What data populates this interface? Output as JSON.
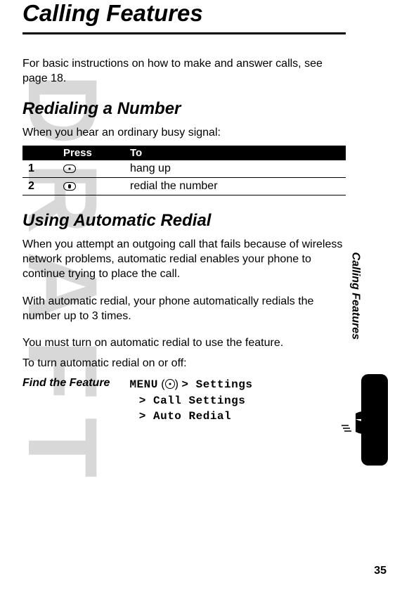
{
  "watermark": "DRAFT",
  "chapter_title": "Calling Features",
  "intro_text": "For basic instructions on how to make and answer calls, see page 18.",
  "sections": {
    "redial": {
      "heading": "Redialing a Number",
      "lead": "When you hear an ordinary busy signal:",
      "table": {
        "headers": [
          "",
          "Press",
          "To"
        ],
        "rows": [
          {
            "num": "1",
            "press": "end-key-icon",
            "to": "hang up"
          },
          {
            "num": "2",
            "press": "send-key-icon",
            "to": "redial the number"
          }
        ]
      }
    },
    "auto_redial": {
      "heading": "Using Automatic Redial",
      "paragraphs": [
        "When you attempt an outgoing call that fails because of wireless network problems, automatic redial enables your phone to continue trying to place the call.",
        "With automatic redial, your phone automatically redials the number up to 3 times.",
        "You must turn on automatic redial to use the feature.",
        "To turn automatic redial on or off:"
      ],
      "find_feature": {
        "label": "Find the Feature",
        "menu_word": "MENU",
        "path_lines": [
          "> Settings",
          "> Call Settings",
          "> Auto Redial"
        ]
      }
    }
  },
  "side_tab_label": "Calling Features",
  "page_number": "35"
}
